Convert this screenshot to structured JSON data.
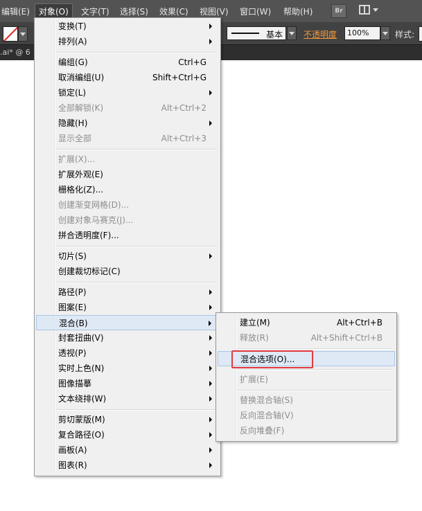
{
  "menubar": {
    "items": [
      "编辑(E)",
      "对象(O)",
      "文字(T)",
      "选择(S)",
      "效果(C)",
      "视图(V)",
      "窗口(W)",
      "帮助(H)"
    ],
    "active_index": 1,
    "bridge_button": "Br"
  },
  "controlbar": {
    "stroke_style": "基本",
    "opacity_label": "不透明度",
    "opacity_value": "100%",
    "style_label": "样式:",
    "stroke_color": "#e0201c"
  },
  "document_tab": {
    "label": ".ai* @ 6"
  },
  "object_menu": {
    "items": [
      {
        "label": "变换(T)",
        "shortcut": "",
        "submenu": true,
        "disabled": false
      },
      {
        "label": "排列(A)",
        "shortcut": "",
        "submenu": true,
        "disabled": false
      },
      {
        "label": "编组(G)",
        "shortcut": "Ctrl+G",
        "submenu": false,
        "disabled": false
      },
      {
        "label": "取消编组(U)",
        "shortcut": "Shift+Ctrl+G",
        "submenu": false,
        "disabled": false
      },
      {
        "label": "锁定(L)",
        "shortcut": "",
        "submenu": true,
        "disabled": false
      },
      {
        "label": "全部解锁(K)",
        "shortcut": "Alt+Ctrl+2",
        "submenu": false,
        "disabled": true
      },
      {
        "label": "隐藏(H)",
        "shortcut": "",
        "submenu": true,
        "disabled": false
      },
      {
        "label": "显示全部",
        "shortcut": "Alt+Ctrl+3",
        "submenu": false,
        "disabled": true
      },
      {
        "label": "扩展(X)...",
        "shortcut": "",
        "submenu": false,
        "disabled": true
      },
      {
        "label": "扩展外观(E)",
        "shortcut": "",
        "submenu": false,
        "disabled": false
      },
      {
        "label": "栅格化(Z)...",
        "shortcut": "",
        "submenu": false,
        "disabled": false
      },
      {
        "label": "创建渐变网格(D)...",
        "shortcut": "",
        "submenu": false,
        "disabled": true
      },
      {
        "label": "创建对象马赛克(J)...",
        "shortcut": "",
        "submenu": false,
        "disabled": true
      },
      {
        "label": "拼合透明度(F)...",
        "shortcut": "",
        "submenu": false,
        "disabled": false
      },
      {
        "label": "切片(S)",
        "shortcut": "",
        "submenu": true,
        "disabled": false
      },
      {
        "label": "创建裁切标记(C)",
        "shortcut": "",
        "submenu": false,
        "disabled": false
      },
      {
        "label": "路径(P)",
        "shortcut": "",
        "submenu": true,
        "disabled": false
      },
      {
        "label": "图案(E)",
        "shortcut": "",
        "submenu": true,
        "disabled": false
      },
      {
        "label": "混合(B)",
        "shortcut": "",
        "submenu": true,
        "disabled": false
      },
      {
        "label": "封套扭曲(V)",
        "shortcut": "",
        "submenu": true,
        "disabled": false
      },
      {
        "label": "透视(P)",
        "shortcut": "",
        "submenu": true,
        "disabled": false
      },
      {
        "label": "实时上色(N)",
        "shortcut": "",
        "submenu": true,
        "disabled": false
      },
      {
        "label": "图像描摹",
        "shortcut": "",
        "submenu": true,
        "disabled": false
      },
      {
        "label": "文本绕排(W)",
        "shortcut": "",
        "submenu": true,
        "disabled": false
      },
      {
        "label": "剪切蒙版(M)",
        "shortcut": "",
        "submenu": true,
        "disabled": false
      },
      {
        "label": "复合路径(O)",
        "shortcut": "",
        "submenu": true,
        "disabled": false
      },
      {
        "label": "画板(A)",
        "shortcut": "",
        "submenu": true,
        "disabled": false
      },
      {
        "label": "图表(R)",
        "shortcut": "",
        "submenu": true,
        "disabled": false
      }
    ],
    "highlighted_index": 18
  },
  "blend_submenu": {
    "items": [
      {
        "label": "建立(M)",
        "shortcut": "Alt+Ctrl+B",
        "disabled": false
      },
      {
        "label": "释放(R)",
        "shortcut": "Alt+Shift+Ctrl+B",
        "disabled": true
      },
      {
        "label": "混合选项(O)...",
        "shortcut": "",
        "disabled": false
      },
      {
        "label": "扩展(E)",
        "shortcut": "",
        "disabled": true
      },
      {
        "label": "替换混合轴(S)",
        "shortcut": "",
        "disabled": true
      },
      {
        "label": "反向混合轴(V)",
        "shortcut": "",
        "disabled": true
      },
      {
        "label": "反向堆叠(F)",
        "shortcut": "",
        "disabled": true
      }
    ],
    "highlighted_index": 2,
    "annotation_color": "#e03a3e"
  }
}
